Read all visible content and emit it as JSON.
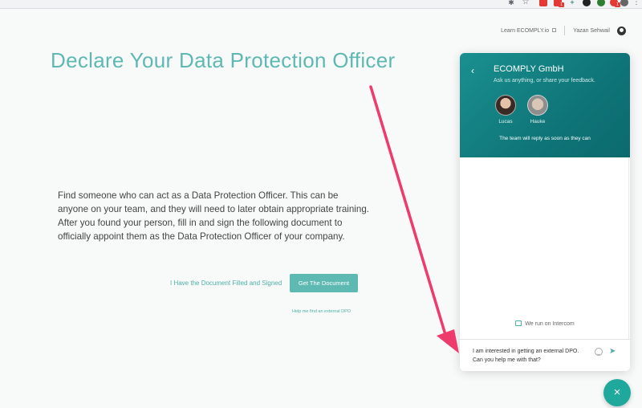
{
  "browser": {
    "extensions": [
      {
        "icon": "puzzle-icon",
        "color": "#5f6368"
      },
      {
        "icon": "star-icon",
        "color": "#5f6368"
      },
      {
        "icon": "extension-a-icon",
        "color": "#e53935"
      },
      {
        "icon": "extension-b-icon",
        "color": "#e53935",
        "badge": "1"
      },
      {
        "icon": "extension-c-icon",
        "color": "#6fa8a0"
      },
      {
        "icon": "extension-d-icon",
        "color": "#222222"
      },
      {
        "icon": "extension-e-icon",
        "color": "#2e7d32"
      },
      {
        "icon": "extension-f-icon",
        "color": "#e53935",
        "badge": "1"
      },
      {
        "icon": "profile-avatar-icon",
        "color": "#666666"
      }
    ],
    "menu_glyph": "⋮"
  },
  "nav": {
    "learn_link": "Learn ECOMPLY.io",
    "user_name": "Yazan Sehwail"
  },
  "main": {
    "title": "Declare Your Data Protection Officer",
    "body": "Find someone who can act as a Data Protection Officer. This can be anyone on your team, and they will need to later obtain appropriate training. After you found your person, fill in and sign the following document to officially appoint them as the Data Protection Officer of your company.",
    "filled_link": "I Have the Document Filled and Signed",
    "get_document_button": "Get The Document",
    "external_dpo_link": "Help me find an external DPO"
  },
  "intercom": {
    "back_glyph": "‹",
    "company": "ECOMPLY GmbH",
    "tagline": "Ask us anything, or share your feedback.",
    "members": [
      {
        "name": "Lucas"
      },
      {
        "name": "Hauke"
      }
    ],
    "reply_note": "The team will reply as soon as they can",
    "powered_by": "We run on Intercom",
    "message": "I am interested in getting an external DPO. Can you help me with that?",
    "send_glyph": "➤",
    "close_glyph": "×"
  },
  "colors": {
    "accent": "#5fb9b3",
    "header_teal": "#0f7578",
    "arrow": "#ef3a6c"
  }
}
